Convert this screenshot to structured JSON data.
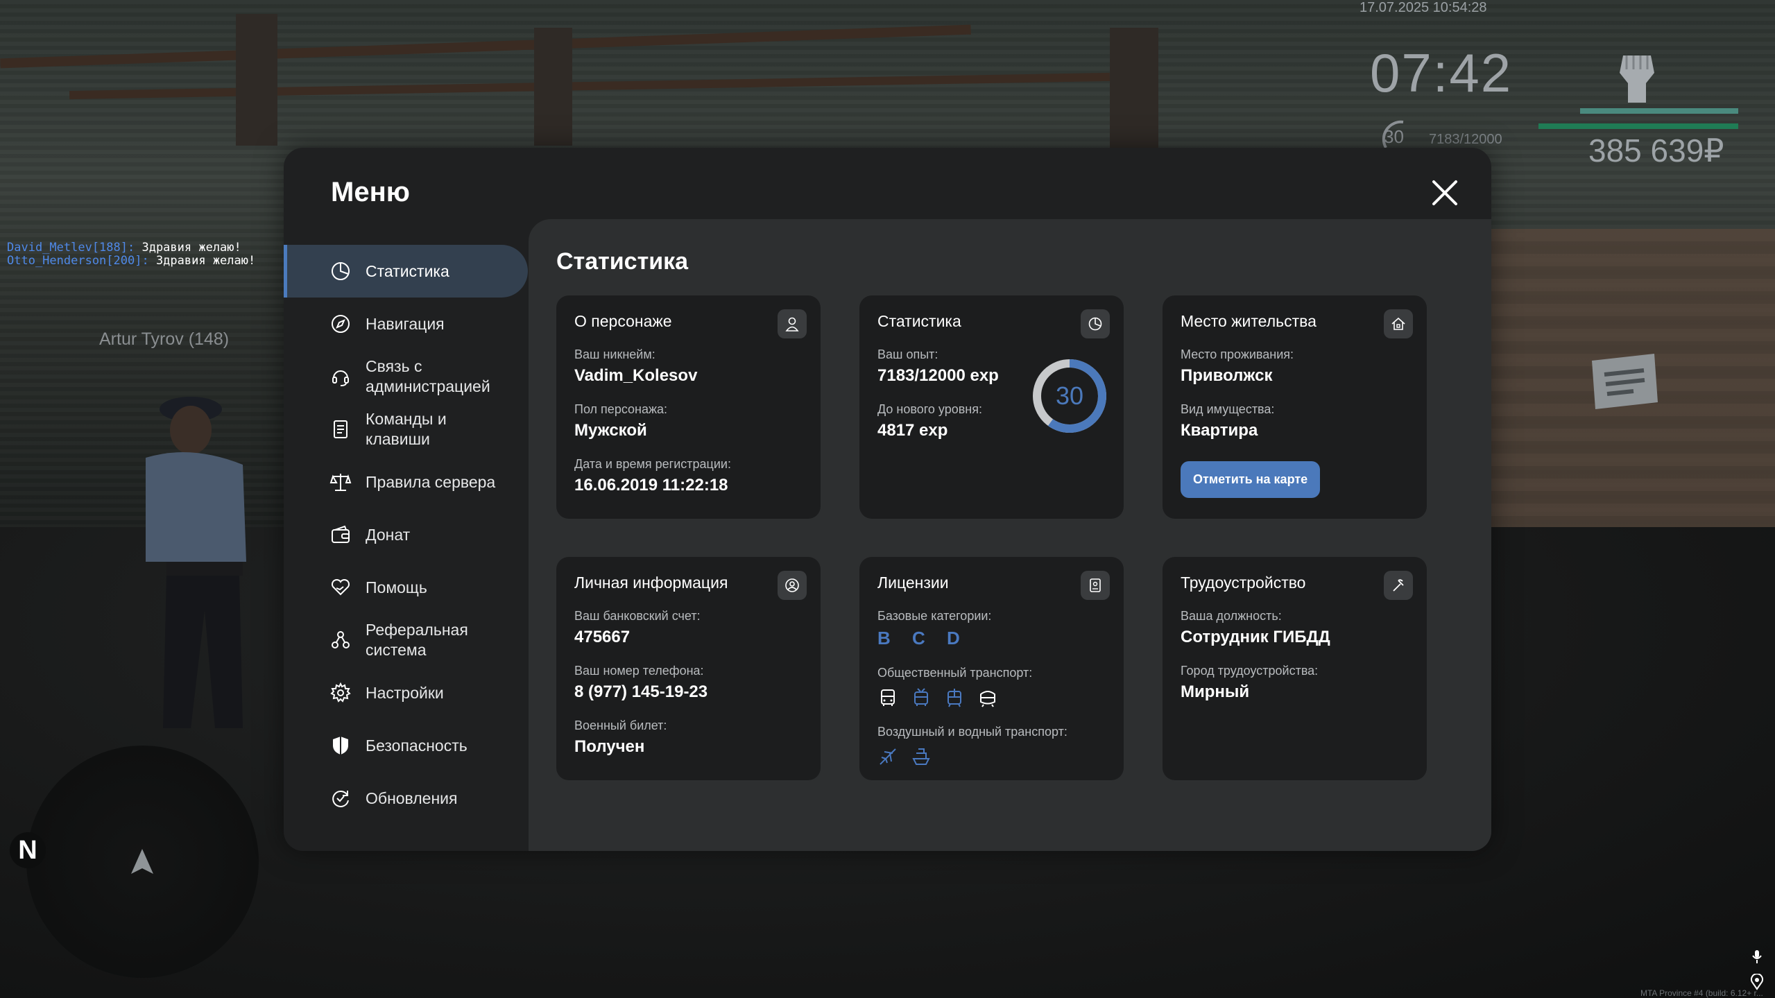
{
  "hud": {
    "datetime": "17.07.2025 10:54:28",
    "clock": "07:42",
    "level": "30",
    "exp": "7183/12000",
    "money": "385 639₽"
  },
  "chat": [
    {
      "nick": "David_Metlev[188]:",
      "msg": " Здравия желаю!"
    },
    {
      "nick": "Otto_Henderson[200]:",
      "msg": " Здравия желаю!"
    }
  ],
  "player_tag": "Artur Tyrov (148)",
  "radar": {
    "north": "N"
  },
  "menu": {
    "title": "Меню",
    "nav": [
      {
        "label": "Статистика",
        "icon": "pie-chart-icon",
        "active": true
      },
      {
        "label": "Навигация",
        "icon": "compass-icon"
      },
      {
        "label": "Связь с\nадминистрацией",
        "icon": "headset-icon"
      },
      {
        "label": "Команды и\nклавиши",
        "icon": "document-icon"
      },
      {
        "label": "Правила сервера",
        "icon": "scales-icon"
      },
      {
        "label": "Донат",
        "icon": "wallet-icon"
      },
      {
        "label": "Помощь",
        "icon": "heart-hand-icon"
      },
      {
        "label": "Реферальная\nсистема",
        "icon": "people-icon"
      },
      {
        "label": "Настройки",
        "icon": "gear-icon"
      },
      {
        "label": "Безопасность",
        "icon": "shield-icon"
      },
      {
        "label": "Обновления",
        "icon": "refresh-check-icon"
      }
    ],
    "section_title": "Статистика",
    "cards": {
      "character": {
        "title": "О персонаже",
        "nick_label": "Ваш никнейм:",
        "nick": "Vadim_Kolesov",
        "gender_label": "Пол персонажа:",
        "gender": "Мужской",
        "reg_label": "Дата и время регистрации:",
        "reg": "16.06.2019 11:22:18"
      },
      "stats": {
        "title": "Статистика",
        "exp_label": "Ваш опыт:",
        "exp": "7183/12000 exp",
        "next_label": "До нового уровня:",
        "next": "4817 exp",
        "level": "30",
        "progress": 0.5986
      },
      "residence": {
        "title": "Место жительства",
        "place_label": "Место проживания:",
        "place": "Приволжск",
        "property_label": "Вид имущества:",
        "property": "Квартира",
        "button": "Отметить на карте"
      },
      "personal": {
        "title": "Личная информация",
        "bank_label": "Ваш банковский счет:",
        "bank": "475667",
        "phone_label": "Ваш номер телефона:",
        "phone": "8 (977) 145-19-23",
        "military_label": "Военный билет:",
        "military": "Получен"
      },
      "licenses": {
        "title": "Лицензии",
        "base_label": "Базовые категории:",
        "base": "B C D",
        "public_label": "Общественный транспорт:",
        "public_icons": [
          "bus-icon",
          "trolleybus-icon",
          "tram-icon",
          "metro-icon"
        ],
        "air_label": "Воздушный и водный транспорт:",
        "air_icons": [
          "plane-icon",
          "boat-icon"
        ]
      },
      "job": {
        "title": "Трудоустройство",
        "position_label": "Ваша должность:",
        "position": "Сотрудник ГИБДД",
        "city_label": "Город трудоустройства:",
        "city": "Мирный"
      }
    }
  },
  "footer": {
    "build": "MTA Province #4 (build: 6.12+ r..."
  },
  "colors": {
    "accent": "#4b79bb",
    "card": "#1c1d1e",
    "panel": "#2d2f30",
    "menu": "#1f2021"
  }
}
